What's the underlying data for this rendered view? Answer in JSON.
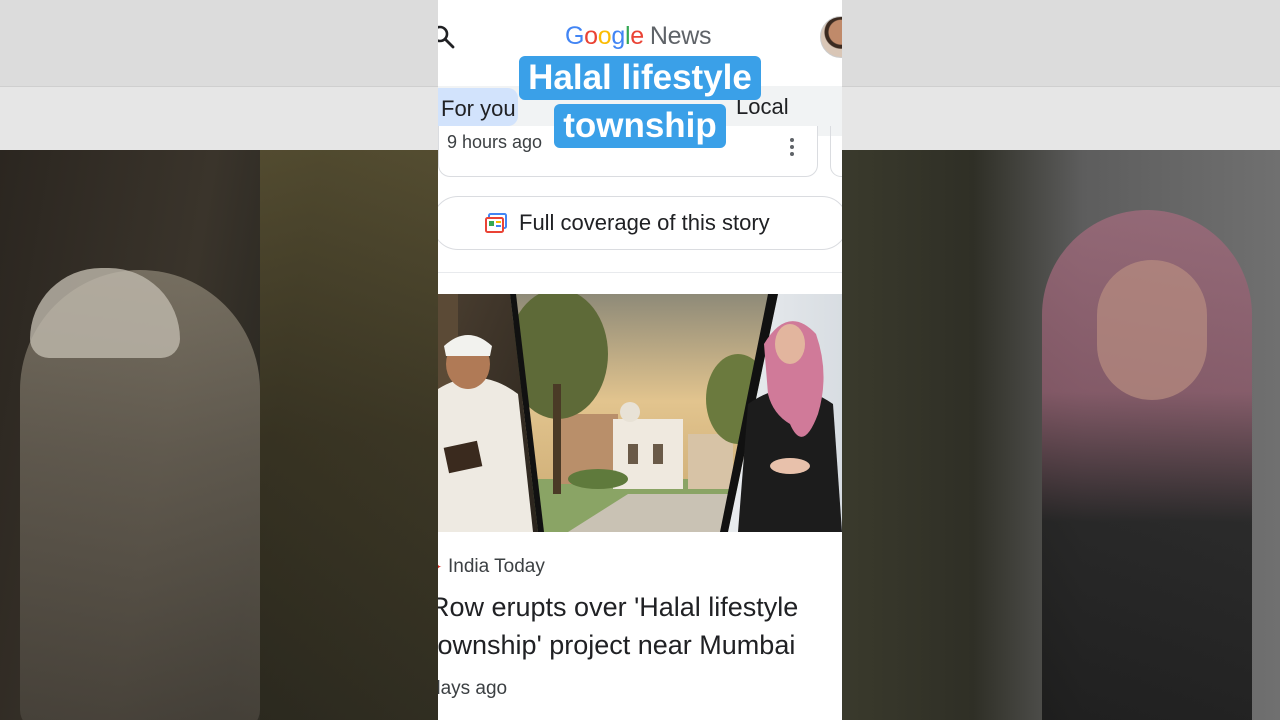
{
  "header": {
    "logo_google": [
      "G",
      "o",
      "o",
      "g",
      "l",
      "e"
    ],
    "logo_news": "News"
  },
  "tabs": [
    {
      "label": "For you",
      "selected": true
    },
    {
      "label": "Local",
      "selected": false
    }
  ],
  "story_card": {
    "time": "9 hours ago"
  },
  "coverage_button": {
    "label": "Full coverage of this story"
  },
  "article": {
    "source": "India Today",
    "headline": "Row erupts over 'Halal lifestyle\ntownship' project near Mumbai",
    "time": "days ago"
  },
  "caption": {
    "line1": "Halal lifestyle",
    "line2": "township"
  },
  "colors": {
    "caption_bg": "#3aa0e8",
    "tab_selected_bg": "#d2e3fc"
  }
}
